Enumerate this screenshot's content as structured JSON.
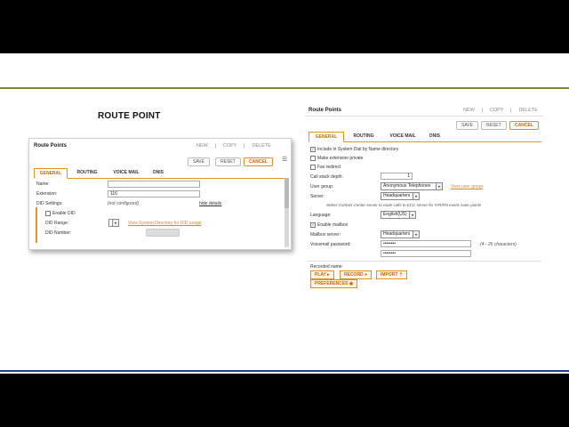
{
  "heading": "ROUTE POINT",
  "left_panel": {
    "title": "Route Points",
    "links": [
      "NEW",
      "COPY",
      "DELETE"
    ],
    "buttons": {
      "save": "SAVE",
      "reset": "RESET",
      "cancel": "CANCEL"
    },
    "tabs": [
      "GENERAL",
      "ROUTING",
      "VOICE MAIL",
      "DNIS"
    ],
    "fields": {
      "name_label": "Name:",
      "name_value": "",
      "extension_label": "Extension:",
      "extension_value": "116",
      "did_settings_label": "DID Settings:",
      "did_settings_value": "(not configured)",
      "hide_details": "hide details",
      "enable_did_label": "Enable DID",
      "did_range_label": "DID Range:",
      "did_directory_link": "View System Directory for DID usage",
      "did_number_label": "DID Number:"
    }
  },
  "right_panel": {
    "title": "Route Points",
    "links": [
      "NEW",
      "COPY",
      "DELETE"
    ],
    "buttons": {
      "save": "SAVE",
      "reset": "RESET",
      "cancel": "CANCEL"
    },
    "tabs": [
      "GENERAL",
      "ROUTING",
      "VOICE MAIL",
      "DNIS"
    ],
    "checks": {
      "include_dial": "Include in System Dial by Name directory",
      "make_private": "Make extension private",
      "fax_redirect": "Fax redirect"
    },
    "fields": {
      "call_stack_label": "Call stack depth:",
      "call_stack_value": "1",
      "user_group_label": "User group:",
      "user_group_value": "Anonymous Telephones",
      "view_user_group": "View user group",
      "server_label": "Server:",
      "server_value": "Headquarters",
      "server_note": "Select Contact Center server to route calls to ECC server for IVR/RN event route points",
      "language_label": "Language:",
      "language_value": "English(US)",
      "enable_mailbox": "Enable mailbox",
      "mailbox_server_label": "Mailbox server:",
      "mailbox_server_value": "Headquarters",
      "vm_password_label": "Voicemail password:",
      "vm_password_value": "••••••••",
      "vm_password_confirm": "••••••••",
      "vm_password_hint": "(4 - 26 characters)",
      "recorded_name_label": "Recorded name:"
    },
    "bottom_buttons": {
      "play": "PLAY ▸",
      "record": "RECORD ●",
      "import": "IMPORT ⇡",
      "preferences": "PREFERENCES ◉"
    }
  }
}
